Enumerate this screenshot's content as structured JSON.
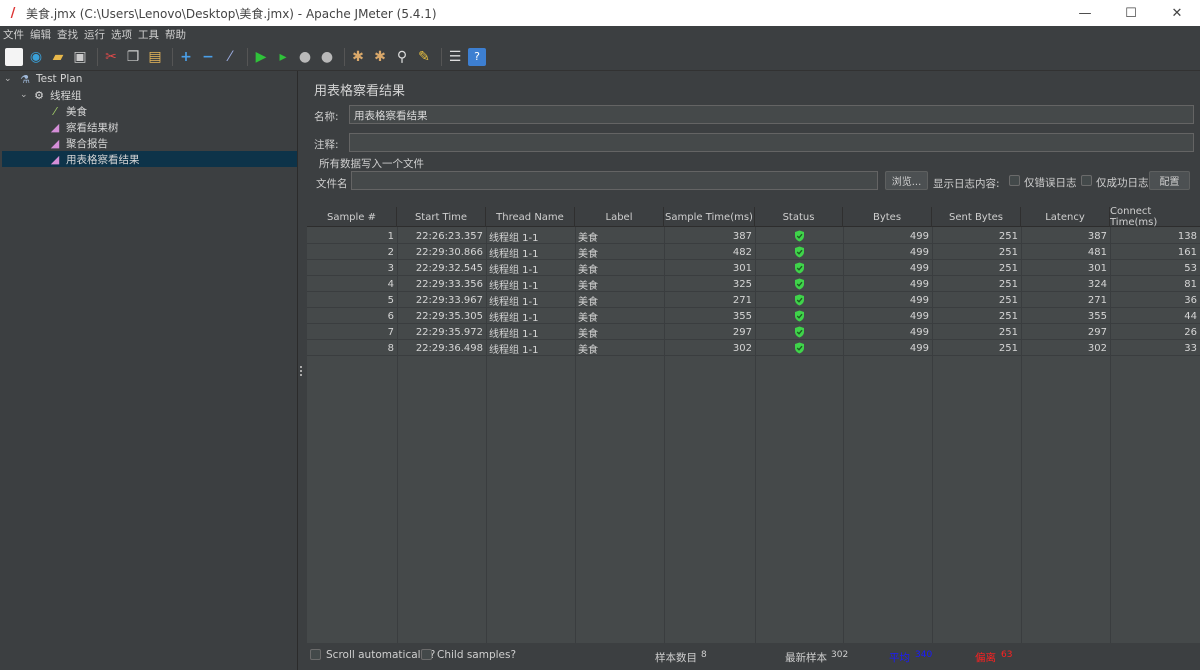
{
  "window": {
    "title": "美食.jmx (C:\\Users\\Lenovo\\Desktop\\美食.jmx) - Apache JMeter (5.4.1)",
    "minimize": "—",
    "maximize": "☐",
    "close": "✕"
  },
  "menu": [
    "文件",
    "编辑",
    "查找",
    "运行",
    "选项",
    "工具",
    "帮助"
  ],
  "tree": {
    "root": "Test Plan",
    "thread_group": "线程组",
    "sampler": "美食",
    "listener_tree": "察看结果树",
    "listener_aggregate": "聚合报告",
    "listener_table": "用表格察看结果"
  },
  "panel": {
    "title": "用表格察看结果",
    "name_label": "名称:",
    "name_value": "用表格察看结果",
    "comment_label": "注释:",
    "comment_value": "",
    "file_section": "所有数据写入一个文件",
    "filename_label": "文件名",
    "filename_value": "",
    "browse": "浏览...",
    "log_content_label": "显示日志内容:",
    "errors_only": "仅错误日志",
    "success_only": "仅成功日志",
    "configure": "配置"
  },
  "table": {
    "columns": [
      "Sample #",
      "Start Time",
      "Thread Name",
      "Label",
      "Sample Time(ms)",
      "Status",
      "Bytes",
      "Sent Bytes",
      "Latency",
      "Connect Time(ms)"
    ],
    "rows": [
      {
        "n": "1",
        "start": "22:26:23.357",
        "thread": "线程组 1-1",
        "label": "美食",
        "time": "387",
        "bytes": "499",
        "sent": "251",
        "latency": "387",
        "connect": "138"
      },
      {
        "n": "2",
        "start": "22:29:30.866",
        "thread": "线程组 1-1",
        "label": "美食",
        "time": "482",
        "bytes": "499",
        "sent": "251",
        "latency": "481",
        "connect": "161"
      },
      {
        "n": "3",
        "start": "22:29:32.545",
        "thread": "线程组 1-1",
        "label": "美食",
        "time": "301",
        "bytes": "499",
        "sent": "251",
        "latency": "301",
        "connect": "53"
      },
      {
        "n": "4",
        "start": "22:29:33.356",
        "thread": "线程组 1-1",
        "label": "美食",
        "time": "325",
        "bytes": "499",
        "sent": "251",
        "latency": "324",
        "connect": "81"
      },
      {
        "n": "5",
        "start": "22:29:33.967",
        "thread": "线程组 1-1",
        "label": "美食",
        "time": "271",
        "bytes": "499",
        "sent": "251",
        "latency": "271",
        "connect": "36"
      },
      {
        "n": "6",
        "start": "22:29:35.305",
        "thread": "线程组 1-1",
        "label": "美食",
        "time": "355",
        "bytes": "499",
        "sent": "251",
        "latency": "355",
        "connect": "44"
      },
      {
        "n": "7",
        "start": "22:29:35.972",
        "thread": "线程组 1-1",
        "label": "美食",
        "time": "297",
        "bytes": "499",
        "sent": "251",
        "latency": "297",
        "connect": "26"
      },
      {
        "n": "8",
        "start": "22:29:36.498",
        "thread": "线程组 1-1",
        "label": "美食",
        "time": "302",
        "bytes": "499",
        "sent": "251",
        "latency": "302",
        "connect": "33"
      }
    ]
  },
  "footer": {
    "scroll_auto": "Scroll automatically?",
    "child_samples": "Child samples?",
    "sample_count_label": "样本数目",
    "sample_count": "8",
    "latest_sample_label": "最新样本",
    "latest_sample": "302",
    "average_label": "平均",
    "average": "340",
    "deviation_label": "偏离",
    "deviation": "63"
  },
  "colors": {
    "average": "#1a1aff",
    "deviation": "#ff2020",
    "status_ok": "#3fd44a"
  }
}
